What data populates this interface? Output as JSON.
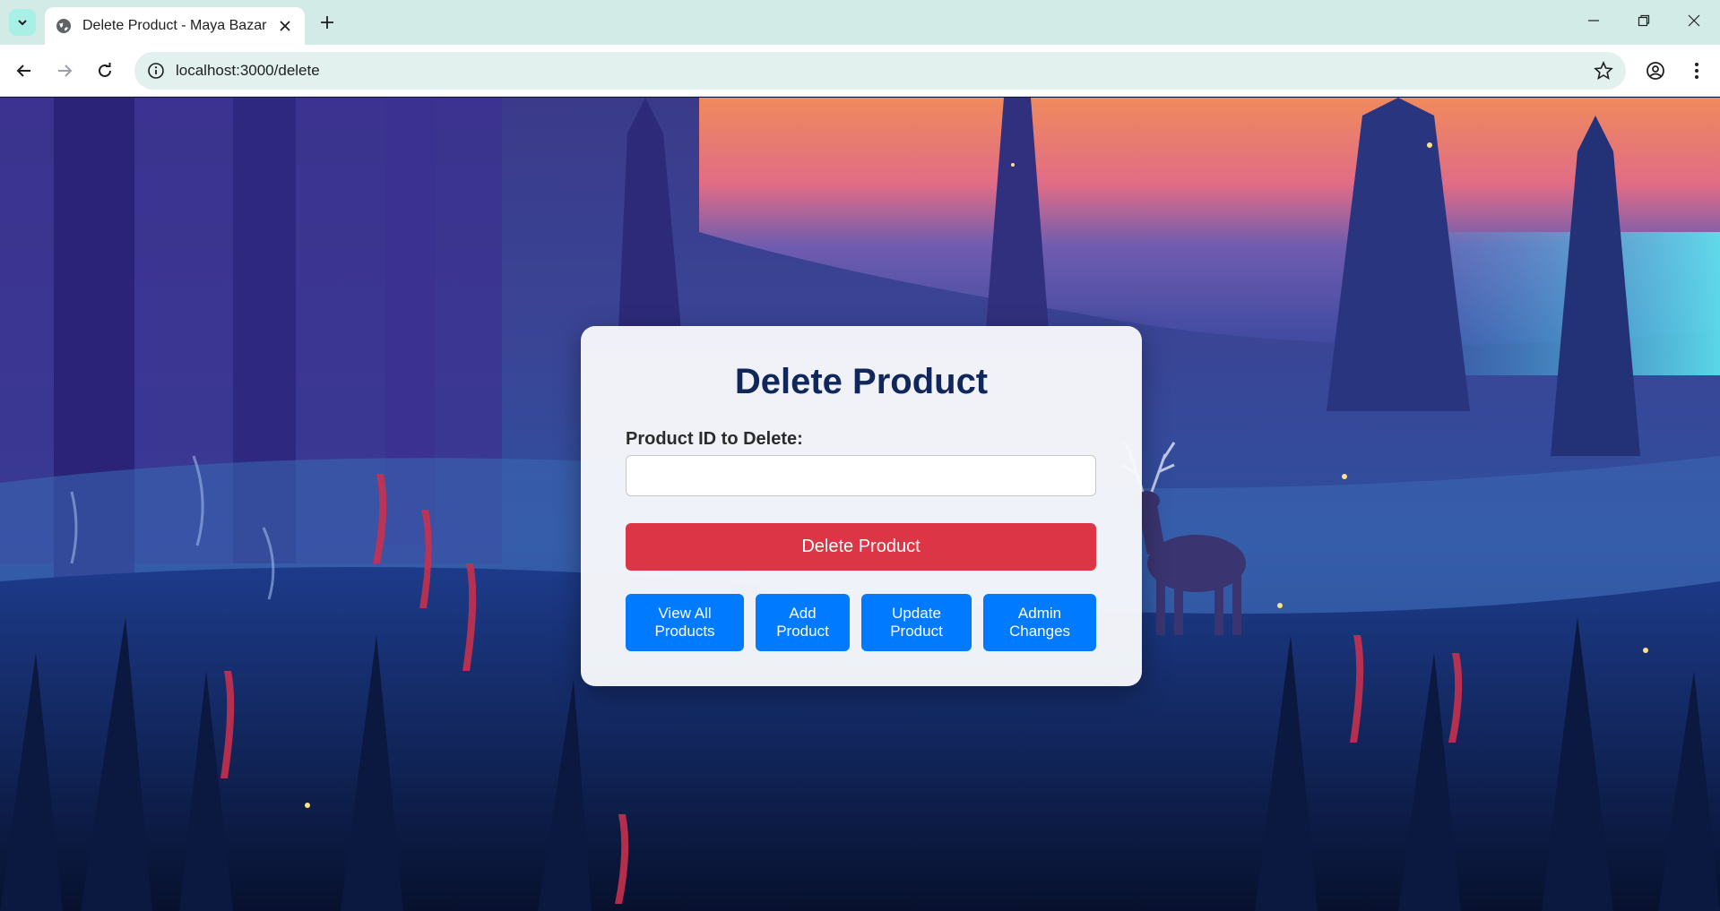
{
  "browser": {
    "tab_title": "Delete Product - Maya Bazar",
    "url": "localhost:3000/delete"
  },
  "form": {
    "heading": "Delete Product",
    "field_label": "Product ID to Delete:",
    "field_value": "",
    "submit_label": "Delete Product"
  },
  "nav": {
    "view_all": "View All\nProducts",
    "add": "Add\nProduct",
    "update": "Update\nProduct",
    "admin": "Admin\nChanges"
  },
  "colors": {
    "danger": "#dc3545",
    "primary": "#007bff",
    "heading": "#10275c"
  }
}
